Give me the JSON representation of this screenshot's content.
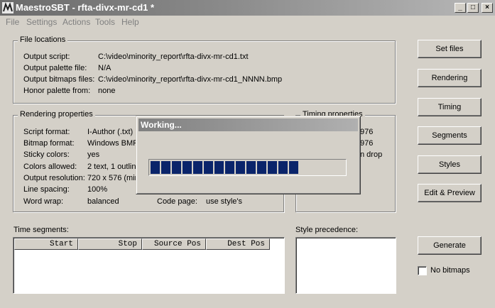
{
  "window": {
    "title": "MaestroSBT - rfta-divx-mr-cd1 *"
  },
  "menu": [
    "File",
    "Settings",
    "Actions",
    "Tools",
    "Help"
  ],
  "file_locations": {
    "title": "File locations",
    "rows": [
      {
        "label": "Output script:",
        "value": "C:\\video\\minority_report\\rfta-divx-mr-cd1.txt"
      },
      {
        "label": "Output palette file:",
        "value": "N/A"
      },
      {
        "label": "Output bitmaps files:",
        "value": "C:\\video\\minority_report\\rfta-divx-mr-cd1_NNNN.bmp"
      },
      {
        "label": "Honor palette from:",
        "value": "none"
      }
    ]
  },
  "rendering": {
    "title": "Rendering properties",
    "rows": [
      {
        "label": "Script format:",
        "value": "I-Author (.txt)"
      },
      {
        "label": "Bitmap format:",
        "value": "Windows BMF"
      },
      {
        "label": "Sticky colors:",
        "value": "yes"
      },
      {
        "label": "Colors allowed:",
        "value": "2 text, 1 outline"
      },
      {
        "label": "Output resolution:",
        "value": "720 x 576 (mir"
      },
      {
        "label": "Line spacing:",
        "value": "100%"
      },
      {
        "label": "Word wrap:",
        "value": "balanced"
      }
    ],
    "code_page_label": "Code page:",
    "code_page_value": "use style's"
  },
  "timing": {
    "title": "Timing properties",
    "values": [
      "976",
      "976",
      "n drop"
    ]
  },
  "buttons": {
    "set_files": "Set files",
    "rendering": "Rendering",
    "timing": "Timing",
    "segments": "Segments",
    "styles": "Styles",
    "edit_preview": "Edit & Preview",
    "generate": "Generate"
  },
  "time_segments": {
    "title": "Time segments:",
    "columns": [
      "Start",
      "Stop",
      "Source Pos",
      "Dest Pos"
    ]
  },
  "style_precedence": {
    "title": "Style precedence:"
  },
  "no_bitmaps": {
    "label": "No bitmaps",
    "checked": false
  },
  "working_dialog": {
    "title": "Working...",
    "progress": 0.82
  }
}
